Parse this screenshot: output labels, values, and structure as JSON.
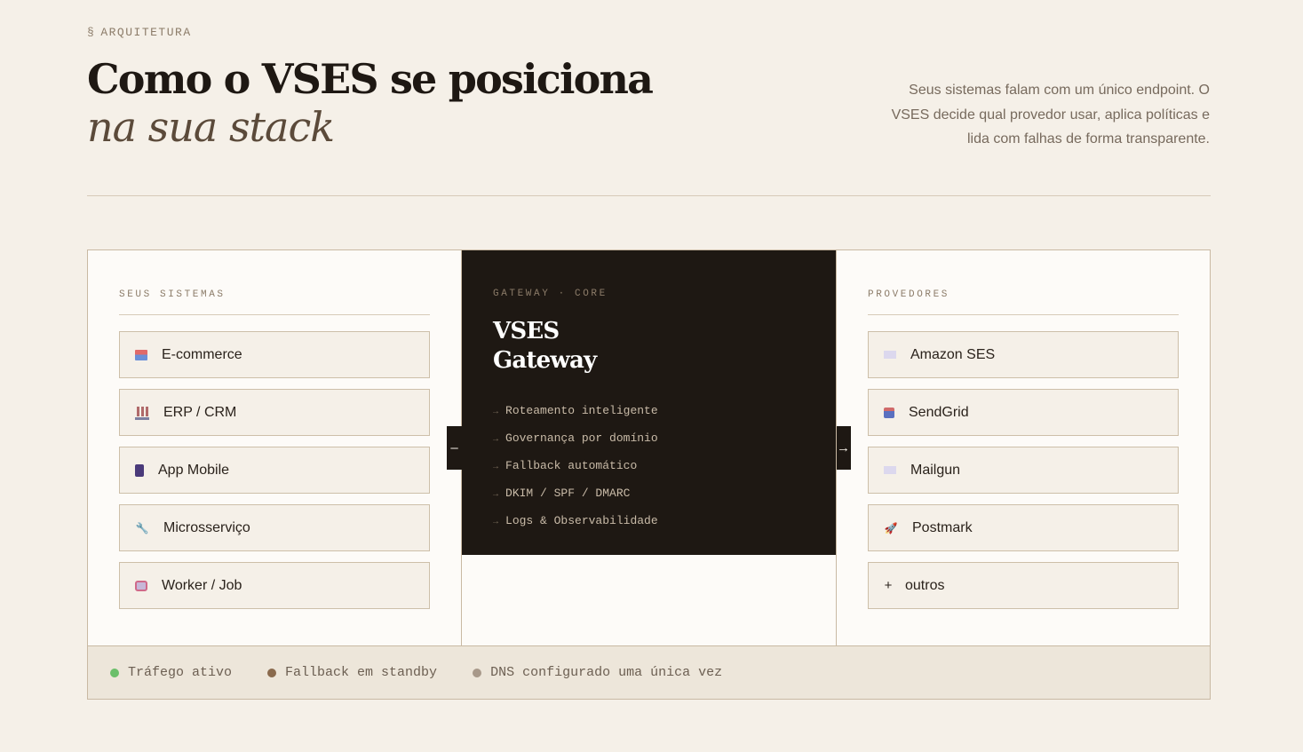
{
  "header": {
    "eyebrow_symbol": "§",
    "eyebrow": "ARQUITETURA",
    "title_line1": "Como o VSES se posiciona",
    "title_line2": "na sua stack",
    "lead": "Seus sistemas falam com um único endpoint. O VSES decide qual provedor usar, aplica políticas e lida com falhas de forma transparente."
  },
  "systems": {
    "label": "SEUS SISTEMAS",
    "items": [
      {
        "label": "E-commerce",
        "icon": "shop-icon"
      },
      {
        "label": "ERP / CRM",
        "icon": "factory-icon"
      },
      {
        "label": "App Mobile",
        "icon": "phone-icon"
      },
      {
        "label": "Microsserviço",
        "icon": "wrench-icon"
      },
      {
        "label": "Worker / Job",
        "icon": "robot-icon"
      }
    ]
  },
  "gateway": {
    "label": "GATEWAY · CORE",
    "title_line1": "VSES",
    "title_line2": "Gateway",
    "features": [
      "Roteamento inteligente",
      "Governança por domínio",
      "Fallback automático",
      "DKIM / SPF / DMARC",
      "Logs & Observabilidade"
    ],
    "arrow_glyph": "→",
    "in_glyph": "–",
    "out_glyph": "→"
  },
  "providers": {
    "label": "PROVEDORES",
    "items": [
      {
        "label": "Amazon SES",
        "icon": "envelope-icon"
      },
      {
        "label": "SendGrid",
        "icon": "inbox-icon"
      },
      {
        "label": "Mailgun",
        "icon": "envelope-icon"
      },
      {
        "label": "Postmark",
        "icon": "rocket-icon"
      },
      {
        "label": "outros",
        "icon": "plus-icon",
        "glyph": "+"
      }
    ]
  },
  "status": [
    {
      "label": "Tráfego ativo",
      "color": "#6bbf6a"
    },
    {
      "label": "Fallback em standby",
      "color": "#8a6a4d"
    },
    {
      "label": "DNS configurado uma única vez",
      "color": "#a8998a"
    }
  ]
}
